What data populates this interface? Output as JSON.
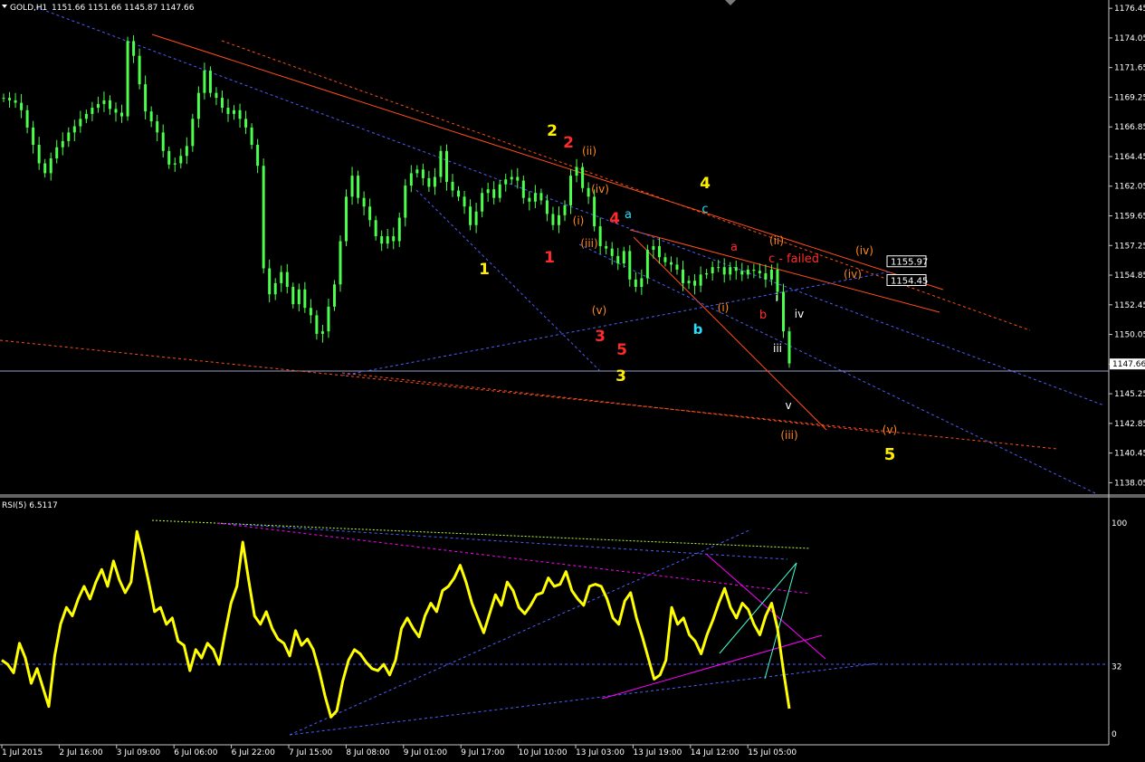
{
  "window": {
    "symbol_label": "GOLD,H1",
    "ohlc": "1151.66 1151.66 1145.87 1147.66",
    "rsi_label": "RSI(5) 6.5117"
  },
  "colors": {
    "background": "#000000",
    "candle": "#4cff4c",
    "rsi_line": "#ffff00",
    "orange_line": "#ff4e1a",
    "blue_dash": "#4b5fff",
    "magenta": "#ff00ff",
    "wave_yellow": "#ffee00",
    "wave_red": "#ff2a2a",
    "wave_orange": "#ff8a1e",
    "wave_cyan": "#22e0ff",
    "wave_white": "#ffffff"
  },
  "chart_data": [
    {
      "type": "candlestick",
      "title": "GOLD,H1",
      "ylim": [
        1137.2,
        1176.9
      ],
      "price_ticks": [
        "1176.45",
        "1174.05",
        "1171.65",
        "1169.25",
        "1166.85",
        "1164.45",
        "1162.05",
        "1159.65",
        "1157.25",
        "1154.85",
        "1152.45",
        "1150.05",
        "1147.65",
        "1145.25",
        "1142.85",
        "1140.45",
        "1138.05"
      ],
      "current_price": "1147.66",
      "price_labels": [
        "1155.97",
        "1154.45"
      ],
      "close_series": [
        1169.2,
        1169.0,
        1168.8,
        1168.2,
        1166.8,
        1165.4,
        1163.9,
        1163.1,
        1164.3,
        1165.2,
        1165.7,
        1166.4,
        1166.9,
        1167.5,
        1167.9,
        1168.4,
        1168.7,
        1169.0,
        1168.3,
        1168.0,
        1167.7,
        1173.8,
        1172.6,
        1170.3,
        1168.1,
        1167.3,
        1166.4,
        1164.9,
        1163.8,
        1163.9,
        1164.5,
        1165.3,
        1167.5,
        1169.6,
        1171.4,
        1169.6,
        1169.2,
        1168.4,
        1167.9,
        1168.2,
        1167.5,
        1166.8,
        1165.4,
        1163.7,
        1155.4,
        1153.3,
        1154.2,
        1155.1,
        1153.9,
        1152.5,
        1153.7,
        1152.2,
        1151.6,
        1150.1,
        1150.3,
        1152.3,
        1154.1,
        1157.6,
        1161.2,
        1162.9,
        1161.1,
        1160.4,
        1159.3,
        1158.0,
        1157.4,
        1158.0,
        1157.6,
        1159.5,
        1162.1,
        1163.1,
        1163.4,
        1162.7,
        1162.0,
        1162.8,
        1164.9,
        1162.4,
        1161.7,
        1161.2,
        1160.4,
        1158.9,
        1160.0,
        1161.5,
        1161.8,
        1161.1,
        1162.2,
        1162.6,
        1162.8,
        1162.5,
        1161.1,
        1160.8,
        1161.5,
        1160.9,
        1159.8,
        1158.9,
        1159.7,
        1160.5,
        1162.9,
        1163.6,
        1161.9,
        1161.2,
        1158.8,
        1157.2,
        1157.0,
        1156.4,
        1155.8,
        1156.8,
        1154.5,
        1153.9,
        1154.6,
        1156.9,
        1157.2,
        1156.3,
        1155.9,
        1155.7,
        1155.3,
        1154.2,
        1154.4,
        1154.0,
        1154.9,
        1155.0,
        1155.5,
        1155.5,
        1154.9,
        1155.5,
        1155.2,
        1154.9,
        1155.3,
        1155.2,
        1155.0,
        1154.5,
        1155.3,
        1153.5,
        1150.3,
        1147.7
      ],
      "rsi": {
        "label": "RSI(5) 6.5117",
        "ylim": [
          0,
          100
        ],
        "ticks": [
          "100",
          "32",
          "0"
        ],
        "level": 32,
        "values": [
          35,
          33,
          29,
          43,
          36,
          24,
          31,
          22,
          13,
          37,
          52,
          60,
          56,
          64,
          70,
          64,
          72,
          78,
          70,
          82,
          73,
          67,
          72,
          96,
          85,
          72,
          58,
          60,
          52,
          55,
          44,
          42,
          30,
          40,
          36,
          43,
          40,
          33,
          48,
          62,
          70,
          91,
          73,
          56,
          52,
          58,
          50,
          45,
          43,
          37,
          49,
          42,
          45,
          40,
          30,
          18,
          8,
          11,
          25,
          35,
          40,
          38,
          34,
          31,
          30,
          33,
          28,
          35,
          50,
          55,
          50,
          46,
          56,
          62,
          58,
          68,
          70,
          74,
          80,
          72,
          62,
          55,
          48,
          57,
          66,
          61,
          72,
          68,
          60,
          57,
          61,
          66,
          67,
          74,
          70,
          71,
          77,
          68,
          64,
          61,
          70,
          71,
          70,
          64,
          55,
          52,
          63,
          67,
          55,
          46,
          36,
          26,
          28,
          35,
          60,
          52,
          55,
          47,
          44,
          38,
          47,
          54,
          62,
          69,
          60,
          55,
          62,
          59,
          52,
          47,
          56,
          62,
          50,
          30,
          12
        ]
      },
      "time_labels": [
        "1 Jul 2015",
        "2 Jul 16:00",
        "3 Jul 09:00",
        "6 Jul 06:00",
        "6 Jul 22:00",
        "7 Jul 15:00",
        "8 Jul 08:00",
        "9 Jul 01:00",
        "9 Jul 17:00",
        "10 Jul 10:00",
        "13 Jul 03:00",
        "13 Jul 19:00",
        "14 Jul 12:00",
        "15 Jul 05:00"
      ]
    }
  ],
  "wave_labels": [
    {
      "text": "2",
      "color": "yellow"
    },
    {
      "text": "2",
      "color": "red"
    },
    {
      "text": "(ii)",
      "color": "orange"
    },
    {
      "text": "(iv)",
      "color": "orange"
    },
    {
      "text": "(i)",
      "color": "orange"
    },
    {
      "text": "(iii)",
      "color": "orange"
    },
    {
      "text": "4",
      "color": "red"
    },
    {
      "text": "a",
      "color": "cyan"
    },
    {
      "text": "4",
      "color": "yellow"
    },
    {
      "text": "c",
      "color": "cyan"
    },
    {
      "text": "(ii)",
      "color": "orange"
    },
    {
      "text": "a",
      "color": "red"
    },
    {
      "text": "c - failed",
      "color": "red"
    },
    {
      "text": "(iv)",
      "color": "orange"
    },
    {
      "text": "(iv)",
      "color": "orange"
    },
    {
      "text": "1",
      "color": "yellow"
    },
    {
      "text": "1",
      "color": "red"
    },
    {
      "text": "(v)",
      "color": "orange"
    },
    {
      "text": "3",
      "color": "red"
    },
    {
      "text": "5",
      "color": "red"
    },
    {
      "text": "3",
      "color": "yellow"
    },
    {
      "text": "b",
      "color": "cyan"
    },
    {
      "text": "(i)",
      "color": "orange"
    },
    {
      "text": "b",
      "color": "red"
    },
    {
      "text": "i",
      "color": "white"
    },
    {
      "text": "iv",
      "color": "white"
    },
    {
      "text": "iii",
      "color": "white"
    },
    {
      "text": "v",
      "color": "white"
    },
    {
      "text": "(iii)",
      "color": "orange"
    },
    {
      "text": "(v)",
      "color": "orange"
    },
    {
      "text": "5",
      "color": "yellow"
    }
  ]
}
